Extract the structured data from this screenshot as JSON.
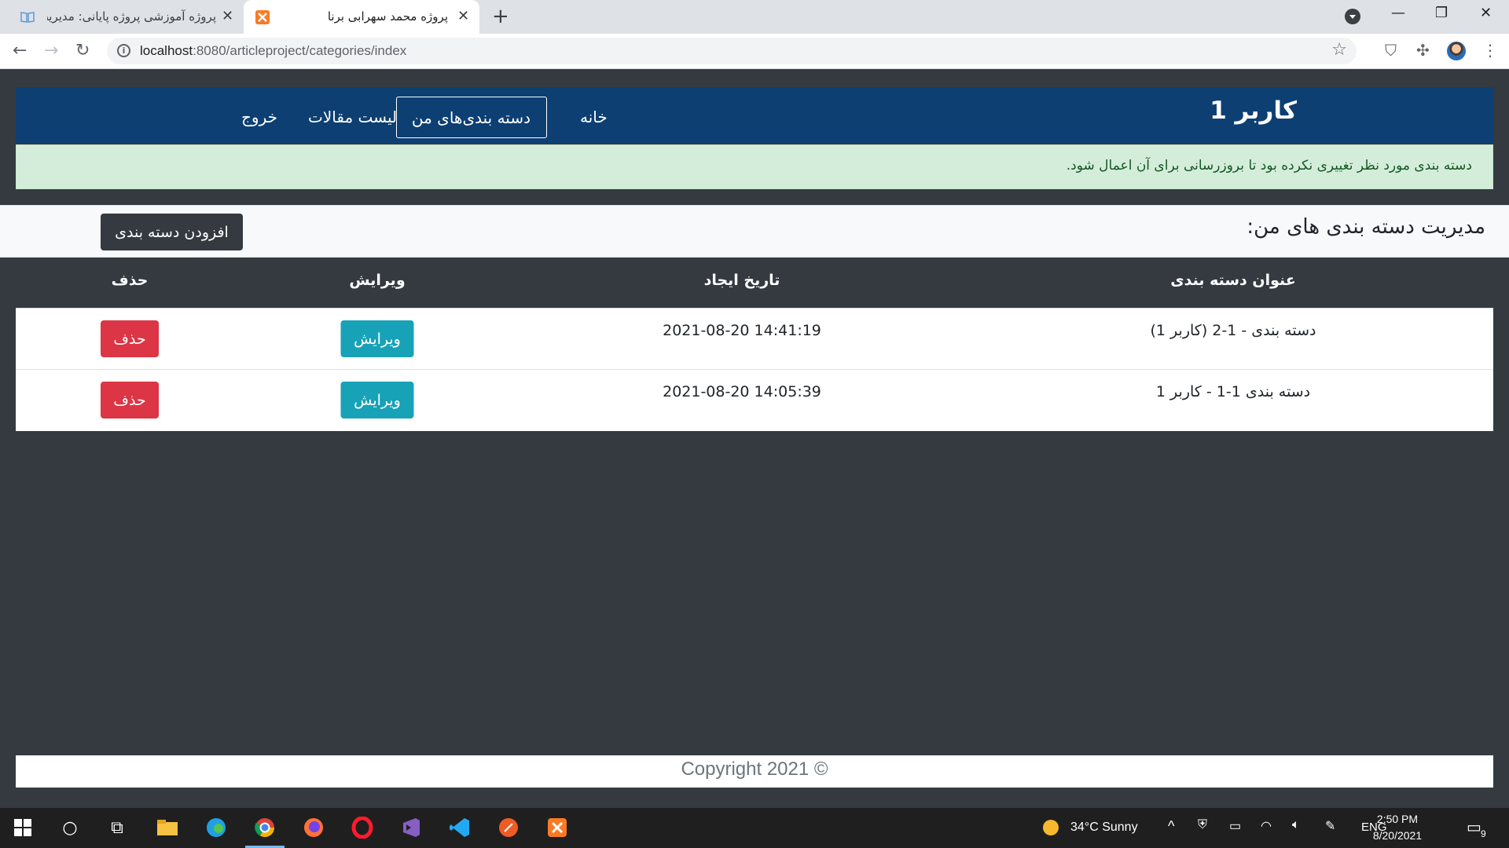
{
  "browser": {
    "tabs": [
      {
        "title": "پروژه آموزشی پروژه پایانی: مدیریت",
        "active": false
      },
      {
        "title": "پروژه محمد سهرابی برنا",
        "active": true
      }
    ],
    "url_host": "localhost",
    "url_path": ":8080/articleproject/categories/index"
  },
  "navbar": {
    "brand": "کاربر 1",
    "items": [
      "خانه",
      "دسته بندی‌های من",
      "لیست مقالات",
      "خروج"
    ]
  },
  "alert": "دسته بندی مورد نظر تغییری نکرده بود تا بروزرسانی برای آن اعمال شود.",
  "card": {
    "title": "مدیریت دسته بندی های من:",
    "add_button": "افزودن دسته بندی"
  },
  "table": {
    "headers": [
      "عنوان دسته بندی",
      "تاریخ ایجاد",
      "ویرایش",
      "حذف"
    ],
    "rows": [
      {
        "title": "دسته بندی - 1-2 (کاربر 1)",
        "date": "2021-08-20 14:41:19",
        "edit": "ویرایش",
        "delete": "حذف"
      },
      {
        "title": "دسته بندی 1-1 - کاربر 1",
        "date": "2021-08-20 14:05:39",
        "edit": "ویرایش",
        "delete": "حذف"
      }
    ]
  },
  "footer": "Copyright 2021 ©",
  "taskbar": {
    "weather": "34°C  Sunny",
    "lang": "ENG",
    "time": "2:50 PM",
    "date": "8/20/2021",
    "notifications": "9"
  },
  "colors": {
    "navbar": "#0d3f73",
    "alert_bg": "#d4edda",
    "edit_button": "#17a2b8",
    "delete_button": "#dc3545",
    "page_bg": "#343a40"
  }
}
